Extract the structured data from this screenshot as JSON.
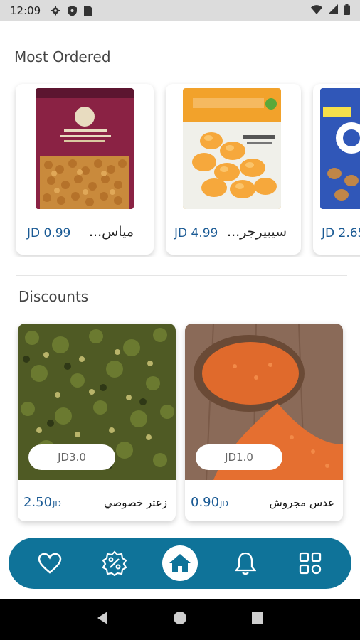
{
  "status_bar": {
    "time": "12:09",
    "icons": [
      "gear-icon",
      "shield-icon",
      "sim-card-icon",
      "wifi-icon",
      "signal-icon",
      "battery-icon"
    ]
  },
  "most_ordered": {
    "title": "Most Ordered",
    "items": [
      {
        "name": "مياس...",
        "price": "JD 0.99"
      },
      {
        "name": "سيبيرجر...",
        "price": "JD 4.99"
      },
      {
        "name": "",
        "price": "JD 2.65"
      }
    ]
  },
  "discounts": {
    "title": "Discounts",
    "items": [
      {
        "name": "زعتر خصوصي",
        "price": "2.50",
        "currency": "JD",
        "old_price": "JD3.0"
      },
      {
        "name": "عدس مجروش",
        "price": "0.90",
        "currency": "JD",
        "old_price": "JD1.0"
      }
    ]
  },
  "bottom_nav": {
    "items": [
      "heart-icon",
      "discount-badge-icon",
      "home-icon",
      "bell-icon",
      "grid-icon"
    ],
    "active": "home-icon"
  },
  "colors": {
    "accent": "#0f7399",
    "price": "#1a5a94"
  }
}
